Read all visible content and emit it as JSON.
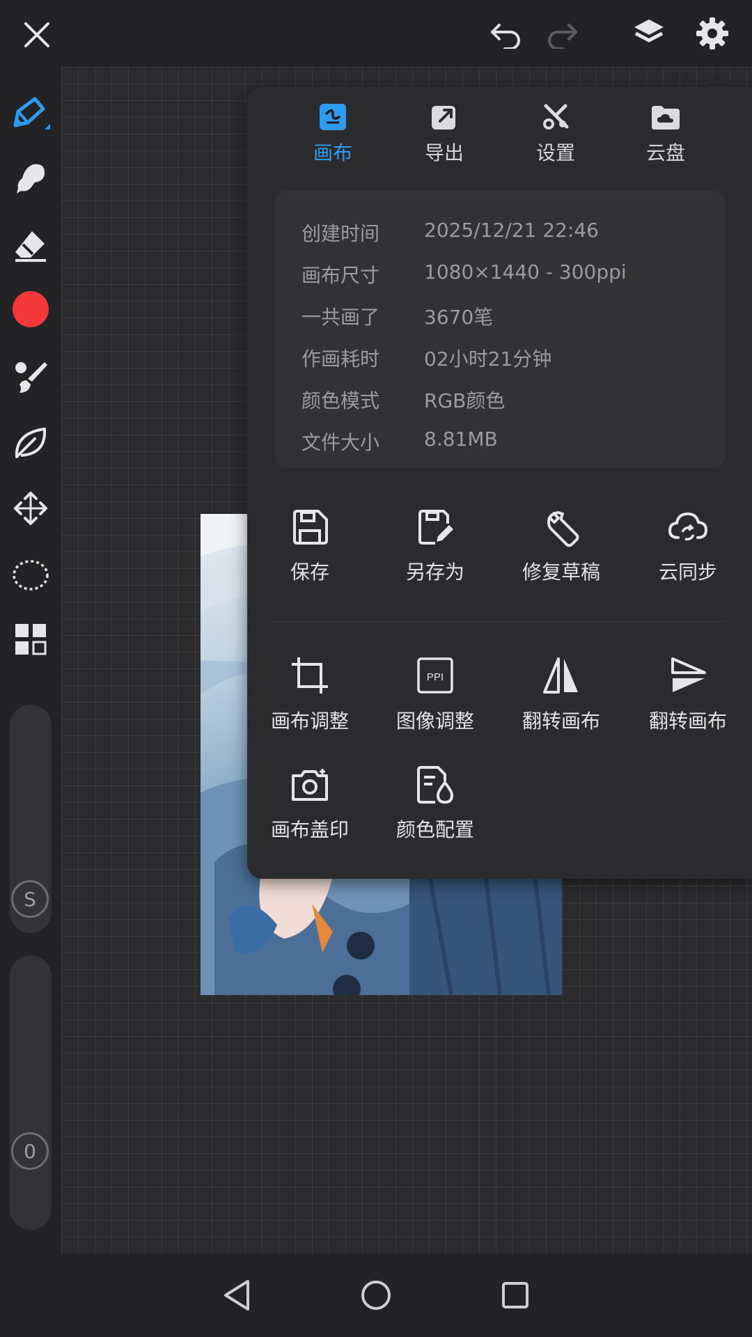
{
  "toolbar": {
    "close_icon": "close-icon",
    "undo_icon": "undo-icon",
    "redo_icon": "redo-icon",
    "layers_icon": "layers-icon",
    "settings_icon": "gear-icon"
  },
  "tools": [
    {
      "name": "pen-tool",
      "icon": "pen-icon",
      "active": true
    },
    {
      "name": "smudge-tool",
      "icon": "smudge-icon"
    },
    {
      "name": "eraser-tool",
      "icon": "eraser-icon"
    },
    {
      "name": "color-picker",
      "icon": "color-swatch",
      "color": "#f23838"
    },
    {
      "name": "brush-tool",
      "icon": "brush-icon"
    },
    {
      "name": "liquify-tool",
      "icon": "leaf-icon"
    },
    {
      "name": "transform-tool",
      "icon": "move-icon"
    },
    {
      "name": "lasso-tool",
      "icon": "lasso-icon"
    },
    {
      "name": "layout-tool",
      "icon": "grid-icon"
    }
  ],
  "sliders": {
    "size_badge": "S",
    "opacity_badge": "0"
  },
  "menu": {
    "tabs": [
      {
        "label": "画布",
        "icon": "canvas-icon",
        "active": true
      },
      {
        "label": "导出",
        "icon": "export-icon"
      },
      {
        "label": "设置",
        "icon": "tools-icon"
      },
      {
        "label": "云盘",
        "icon": "cloud-folder-icon"
      }
    ],
    "info": [
      {
        "key": "创建时间",
        "value": "2025/12/21 22:46"
      },
      {
        "key": "画布尺寸",
        "value": "1080×1440 - 300ppi"
      },
      {
        "key": "一共画了",
        "value": "3670笔"
      },
      {
        "key": "作画耗时",
        "value": "02小时21分钟"
      },
      {
        "key": "颜色模式",
        "value": "RGB颜色"
      },
      {
        "key": "文件大小",
        "value": "8.81MB"
      }
    ],
    "actions_row1": [
      {
        "label": "保存",
        "icon": "save-icon"
      },
      {
        "label": "另存为",
        "icon": "save-as-icon"
      },
      {
        "label": "修复草稿",
        "icon": "wrench-icon"
      },
      {
        "label": "云同步",
        "icon": "cloud-sync-icon"
      }
    ],
    "actions_row2": [
      {
        "label": "画布调整",
        "icon": "crop-icon"
      },
      {
        "label": "图像调整",
        "icon": "ppi-icon",
        "icon_text": "PPI"
      },
      {
        "label": "翻转画布",
        "icon": "flip-horizontal-icon"
      },
      {
        "label": "翻转画布",
        "icon": "flip-vertical-icon"
      }
    ],
    "actions_row3": [
      {
        "label": "画布盖印",
        "icon": "camera-icon"
      },
      {
        "label": "颜色配置",
        "icon": "color-profile-icon"
      }
    ]
  },
  "accent_color": "#2f9bf0",
  "navigation": {
    "back_icon": "back-icon",
    "home_icon": "home-icon",
    "recents_icon": "recents-icon"
  }
}
